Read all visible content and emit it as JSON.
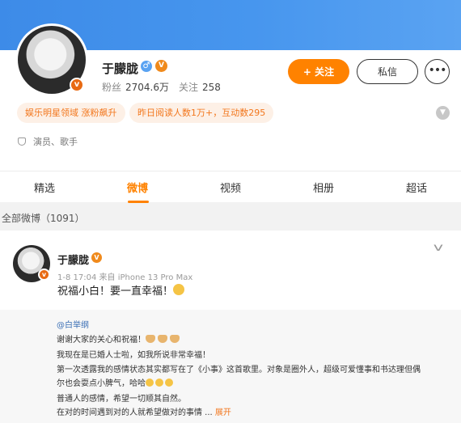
{
  "profile": {
    "name": "于朦胧",
    "gender_icon": "male-icon",
    "vip_icon": "vip-badge",
    "fans_label": "粉丝",
    "fans_count": "2704.6万",
    "following_label": "关注",
    "following_count": "258",
    "follow_button": "+ 关注",
    "message_button": "私信",
    "more_button": "•••",
    "tags": [
      "娱乐明星领域 涨粉飙升",
      "昨日阅读人数1万+，互动数295"
    ],
    "info": "演员、歌手"
  },
  "tabs": [
    "精选",
    "微博",
    "视频",
    "相册",
    "超话"
  ],
  "active_tab": "微博",
  "section_title": "全部微博（1091）",
  "post": {
    "author": "于朦胧",
    "time": "1-8 17:04",
    "source": "来自 iPhone 13 Pro Max",
    "text": "祝福小白！要一直幸福！",
    "repost": {
      "author": "@白举纲",
      "lines": [
        "谢谢大家的关心和祝福！",
        "我现在是已婚人士啦，如我所说非常幸福！",
        "第一次透露我的感情状态其实都写在了《小事》这首歌里。对象是圈外人，超级可爱懂事和书达理但偶",
        "尔也会耍点小脾气，哈哈",
        "普通人的感情，希望一切顺其自然。",
        "在对的时间遇到对的人就希望做对的事情 ..."
      ],
      "expand_label": "展开"
    }
  },
  "colors": {
    "accent": "#ff8200",
    "banner": "#4796ee",
    "tag_text": "#f2761c",
    "tag_bg": "#fdf0e6"
  }
}
